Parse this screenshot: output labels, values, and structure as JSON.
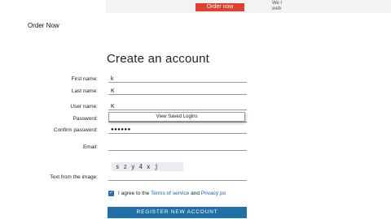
{
  "banner": {
    "order_button": "Order now",
    "side_text_1": "We l",
    "side_text_2": "web"
  },
  "nav": {
    "order_link": "Order Now"
  },
  "form": {
    "title": "Create an account",
    "fields": {
      "first_name": {
        "label": "First name:",
        "value": "k"
      },
      "last_name": {
        "label": "Last name:",
        "value": "K"
      },
      "user_name": {
        "label": "User name:",
        "value": "K"
      },
      "password": {
        "label": "Password:",
        "value": ""
      },
      "confirm_password": {
        "label": "Confirm password:",
        "value": "●●●●●●"
      },
      "email": {
        "label": "Email:",
        "value": ""
      },
      "captcha_text": {
        "label": "Text from the image:",
        "value": ""
      }
    },
    "autofill_option": "View Saved Logins",
    "captcha_image_text": "szy4xj",
    "agree": {
      "prefix": "I agree to the ",
      "terms_link": "Terms of service",
      "and": " and ",
      "privacy_link": "Privacy po"
    },
    "register_button": "REGISTER NEW ACCOUNT"
  },
  "colors": {
    "accent_button": "#1f6fa8",
    "order_button": "#e2402e",
    "link": "#1f5fa8"
  }
}
